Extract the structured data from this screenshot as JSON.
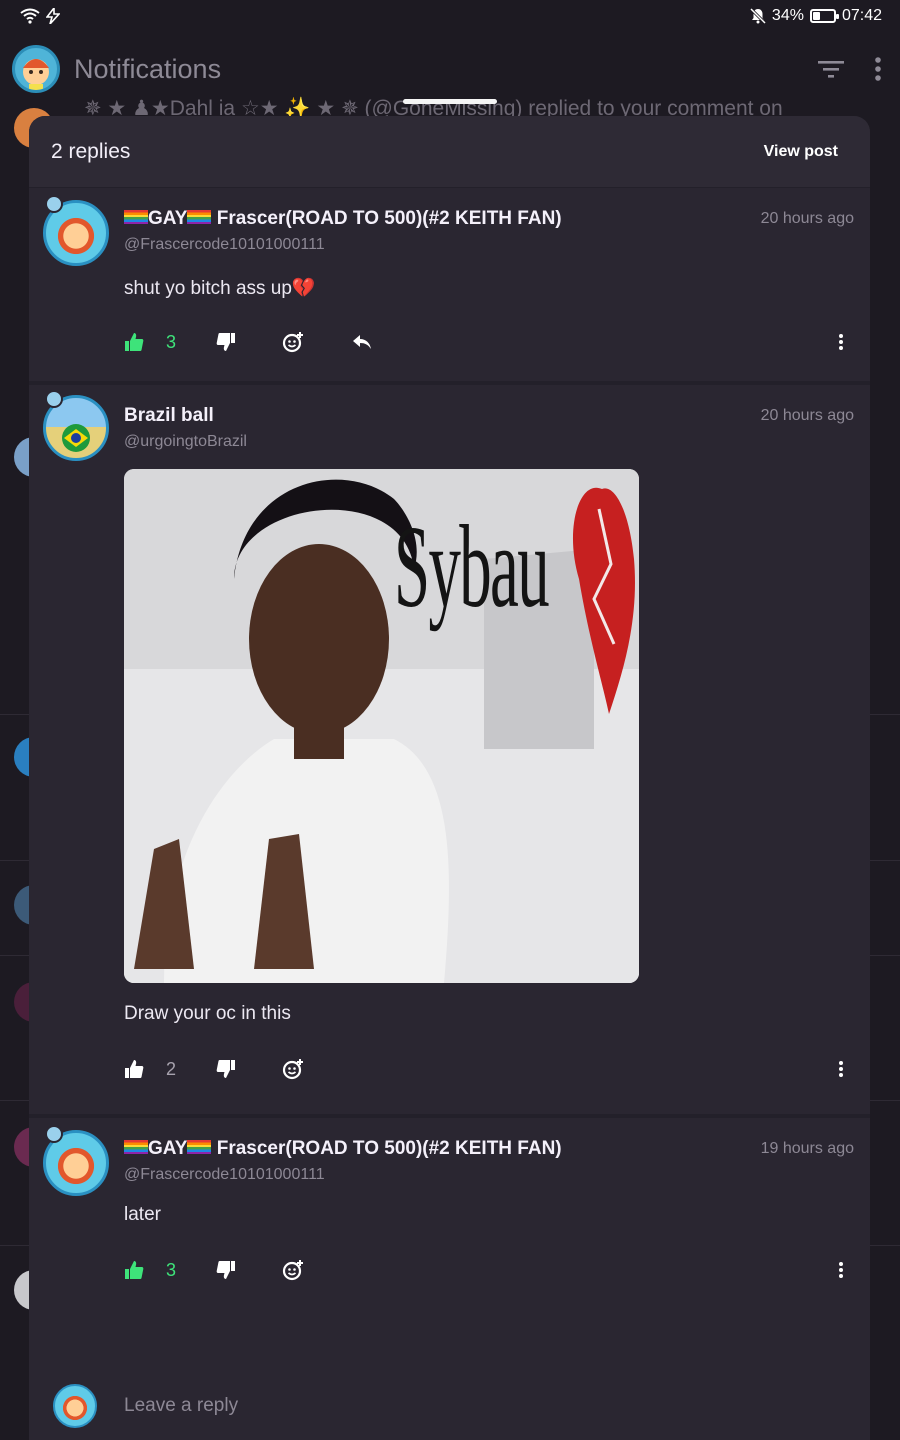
{
  "status_bar": {
    "battery": "34%",
    "time": "07:42",
    "battery_level": 0.34
  },
  "header": {
    "title": "Notifications"
  },
  "background_peek": {
    "text": "✵ ★  ♟★Dahl ia ☆★ ✨ ★ ✵ (@GoneMissing) replied to your comment on"
  },
  "sheet": {
    "title": "2 replies",
    "view_post_label": "View post",
    "replies": [
      {
        "name_prefix": "GAY",
        "name": "Frascer(ROAD TO 500)(#2 KEITH FAN)",
        "handle": "@Frascercode10101000111",
        "time": "20 hours ago",
        "text": "shut yo bitch ass up💔",
        "likes": "3",
        "liked": true
      },
      {
        "name": "Brazil ball",
        "handle": "@urgoingtoBrazil",
        "time": "20 hours ago",
        "image_caption_text": "Sybau",
        "text": "Draw your oc in this",
        "likes": "2",
        "liked": false
      },
      {
        "name_prefix": "GAY",
        "name": "Frascer(ROAD TO 500)(#2 KEITH FAN)",
        "handle": "@Frascercode10101000111",
        "time": "19 hours ago",
        "text": "later",
        "likes": "3",
        "liked": true
      }
    ]
  },
  "reply_bar": {
    "placeholder": "Leave a reply"
  },
  "icons": {
    "like": "thumbs-up-icon",
    "dislike": "thumbs-down-icon",
    "react": "add-reaction-icon",
    "reply": "reply-arrow-icon",
    "more": "more-vertical-icon",
    "filter": "filter-icon"
  },
  "colors": {
    "liked": "#3ee37a",
    "neutral": "#ffffff",
    "sheet_bg": "#2a2631",
    "accent_ring": "#2a90c2"
  }
}
